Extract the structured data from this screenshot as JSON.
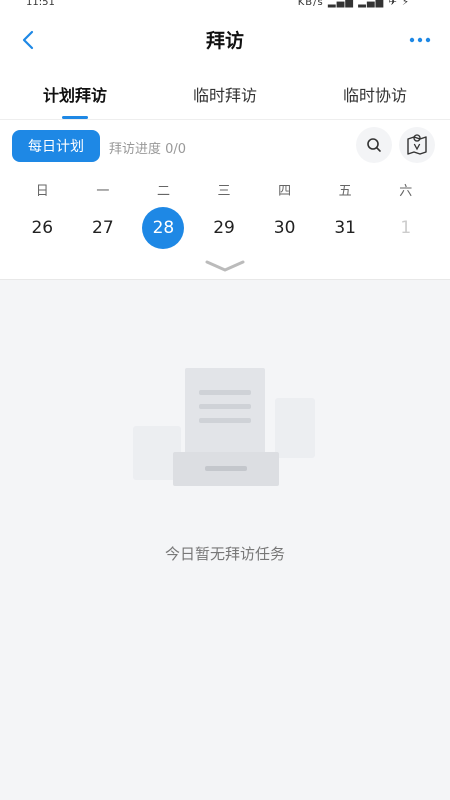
{
  "status_bar": {
    "time": "11:51",
    "network": "KB/s"
  },
  "nav": {
    "title": "拜访",
    "back_icon": "chevron-left-icon",
    "more_icon": "more-dots-icon"
  },
  "tabs": [
    {
      "label": "计划拜访",
      "active": true
    },
    {
      "label": "临时拜访",
      "active": false
    },
    {
      "label": "临时协访",
      "active": false
    }
  ],
  "filter": {
    "daily_plan_label": "每日计划",
    "progress_label": "拜访进度 0/0",
    "search_icon": "search-icon",
    "map_icon": "map-pin-icon"
  },
  "calendar": {
    "weekdays": [
      "日",
      "一",
      "二",
      "三",
      "四",
      "五",
      "六"
    ],
    "dates": [
      "26",
      "27",
      "28",
      "29",
      "30",
      "31",
      "1"
    ],
    "selected_index": 2,
    "muted_index": 6,
    "expand_icon": "chevron-down-icon"
  },
  "empty_state": {
    "message": "今日暂无拜访任务"
  },
  "colors": {
    "accent": "#1e88e5",
    "background": "#f4f5f7"
  }
}
